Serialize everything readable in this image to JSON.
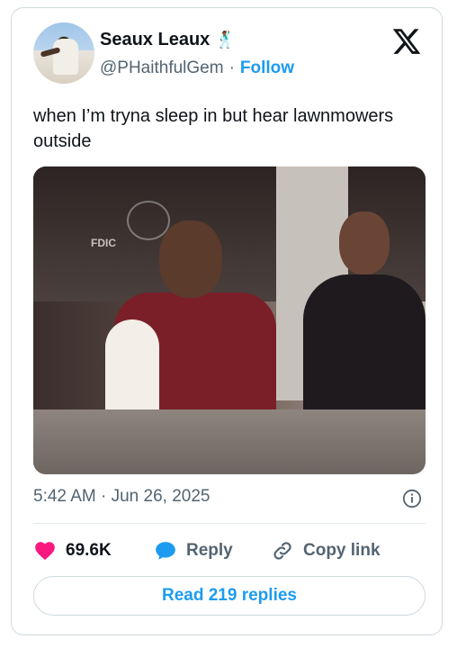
{
  "author": {
    "name": "Seaux Leaux",
    "emoji": "🕺🏾",
    "handle": "@PHaithfulGem",
    "separator": "·",
    "follow_label": "Follow"
  },
  "tweet": {
    "text": "when I’m tryna sleep in but hear lawnmowers outside",
    "media_sign_text": "FDIC",
    "timestamp": "5:42 AM · Jun 26, 2025"
  },
  "actions": {
    "likes_count": "69.6K",
    "reply_label": "Reply",
    "copy_link_label": "Copy link"
  },
  "footer": {
    "read_replies_label": "Read 219 replies"
  },
  "colors": {
    "accent": "#1d9bf0",
    "like": "#f91880",
    "muted": "#536471"
  },
  "icons": [
    "x-logo-icon",
    "info-icon",
    "heart-icon",
    "speech-bubble-icon",
    "link-icon"
  ]
}
